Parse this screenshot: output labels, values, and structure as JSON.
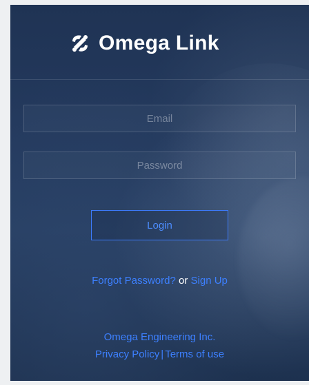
{
  "brand": {
    "name": "Omega Link",
    "logo_icon": "omega-swirl-icon"
  },
  "form": {
    "email_placeholder": "Email",
    "password_placeholder": "Password",
    "login_label": "Login"
  },
  "links": {
    "forgot_password": "Forgot Password?",
    "or_text": " or ",
    "sign_up": "Sign Up"
  },
  "footer": {
    "company": "Omega Engineering Inc.",
    "privacy": "Privacy Policy",
    "separator": "|",
    "terms": "Terms of use"
  },
  "colors": {
    "accent": "#3d80ff",
    "background": "#243a5e",
    "text": "#ffffff"
  }
}
